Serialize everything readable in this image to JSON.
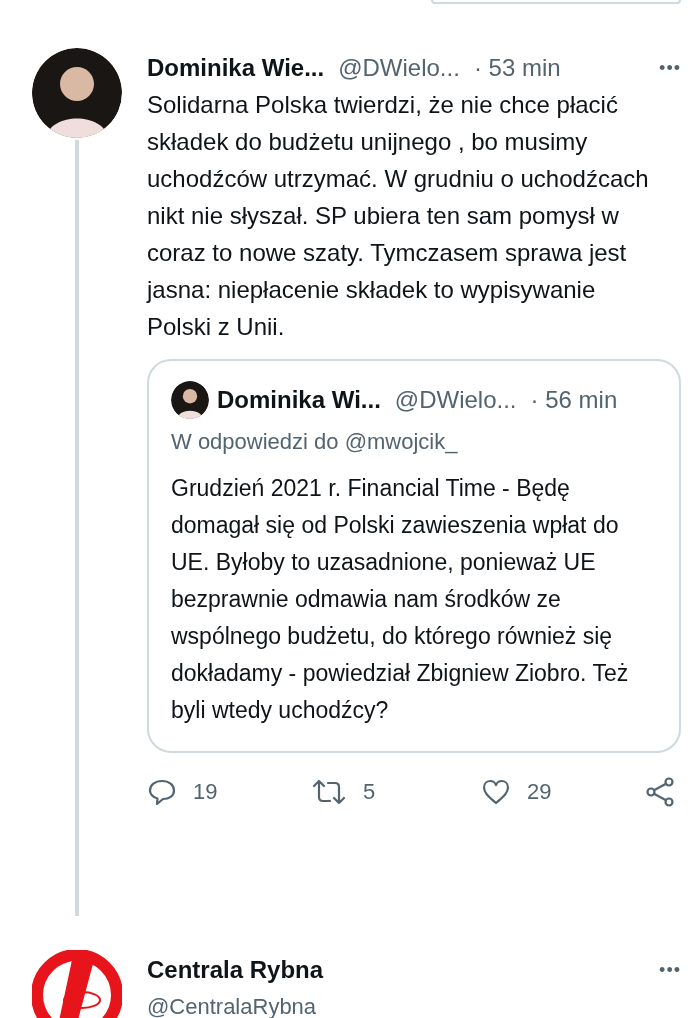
{
  "tweet": {
    "name": "Dominika Wie...",
    "handle": "@DWielo...",
    "time": "· 53 min",
    "more": "•••",
    "text": "Solidarna Polska twierdzi, że nie chce płacić składek do budżetu unijnego , bo musimy uchodźców utrzymać. W grudniu o uchodźcach nikt nie słyszał. SP ubiera ten sam pomysł w coraz to nowe szaty. Tymczasem sprawa jest jasna: niepłacenie składek to wypisywanie Polski z Unii.",
    "quote": {
      "name": "Dominika Wi...",
      "handle": "@DWielo...",
      "time": "· 56 min",
      "reply_to": "W odpowiedzi do @mwojcik_",
      "text": "Grudzień 2021 r. Financial Time - Będę domagał się od Polski zawieszenia wpłat do UE. Byłoby to uzasadnione, ponieważ UE bezprawnie odmawia nam środków ze wspólnego budżetu, do którego również się dokładamy - powiedział Zbigniew Ziobro. Też byli wtedy uchodźcy?"
    },
    "actions": [
      {
        "kind": "reply",
        "count": "19"
      },
      {
        "kind": "retweet",
        "count": "5"
      },
      {
        "kind": "like",
        "count": "29"
      },
      {
        "kind": "share"
      }
    ]
  },
  "next_tweet": {
    "name": "Centrala Rybna",
    "handle": "@CentralaRybna",
    "more": "•••"
  }
}
